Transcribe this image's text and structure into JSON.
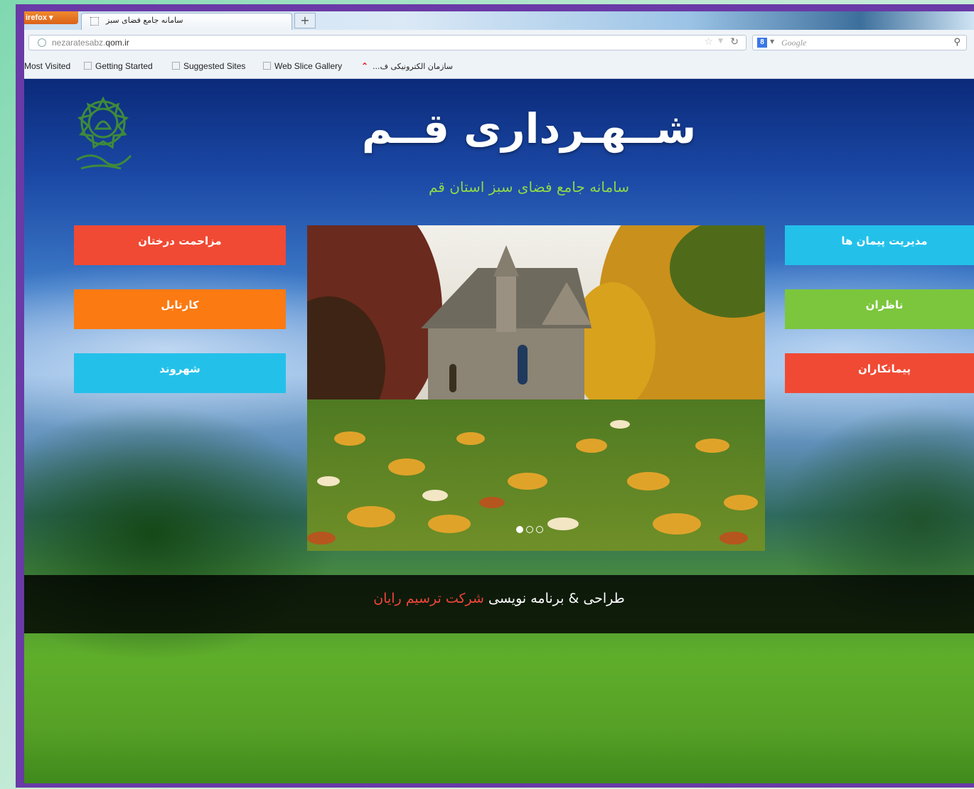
{
  "browser": {
    "menu_button": "irefox",
    "tab_title": "سامانه جامع فضای سبز",
    "new_tab": "+",
    "url_host": "nezaratesabz.",
    "url_domain": "qom.ir",
    "search_engine": "Google",
    "bookmarks": [
      {
        "label": "Most Visited"
      },
      {
        "label": "Getting Started"
      },
      {
        "label": "Suggested Sites"
      },
      {
        "label": "Web Slice Gallery"
      },
      {
        "label": "...سازمان الکترونیکی ف"
      }
    ]
  },
  "page": {
    "title": "شــهـرداری قــم",
    "subtitle": "سامانه جامع فضای سبز استان قم",
    "left_buttons": [
      {
        "label": "مزاحمت درختان",
        "color": "#f04a34"
      },
      {
        "label": "کارتابل",
        "color": "#fb7a12"
      },
      {
        "label": "شهروند",
        "color": "#23c1ea"
      }
    ],
    "right_buttons": [
      {
        "label": "مدیریت پیمان ها",
        "color": "#23c1ea"
      },
      {
        "label": "ناظران",
        "color": "#7cc63d"
      },
      {
        "label": "پیمانکاران",
        "color": "#f04a34"
      }
    ],
    "slider": {
      "slide_count": 3,
      "active_index": 0
    },
    "footer": {
      "prefix": "طراحی & برنامه نویسی",
      "company": "شرکت ترسیم رایان"
    }
  },
  "colors": {
    "frame": "#6a3aa6",
    "subtitle": "#8fd84a",
    "company": "#f0453a"
  }
}
